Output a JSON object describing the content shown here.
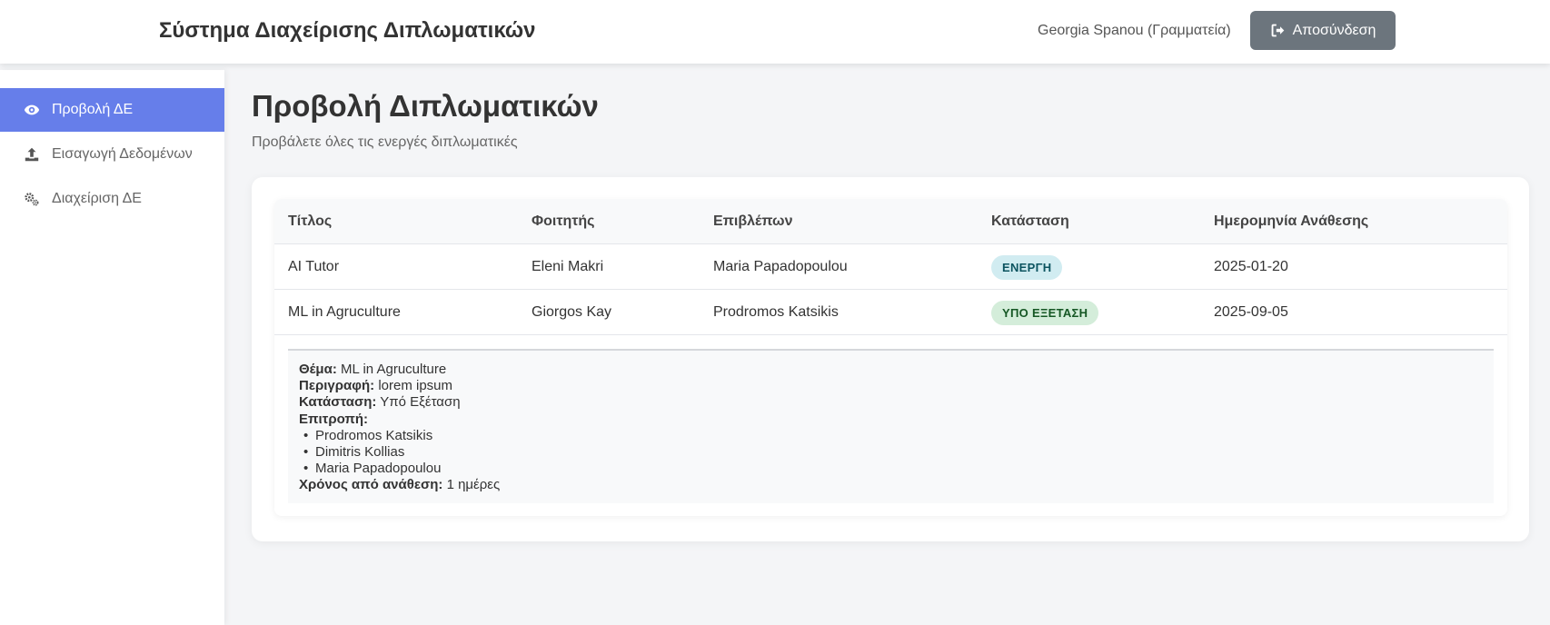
{
  "header": {
    "app_title": "Σύστημα Διαχείρισης Διπλωματικών",
    "user": "Georgia Spanou (Γραμματεία)",
    "logout_label": "Αποσύνδεση",
    "logout_icon": "sign-out-icon"
  },
  "sidebar": {
    "items": [
      {
        "label": "Προβολή ΔΕ",
        "icon": "eye-icon",
        "active": true
      },
      {
        "label": "Εισαγωγή Δεδομένων",
        "icon": "upload-icon",
        "active": false
      },
      {
        "label": "Διαχείριση ΔΕ",
        "icon": "gears-icon",
        "active": false
      }
    ]
  },
  "main": {
    "title": "Προβολή Διπλωματικών",
    "subtitle": "Προβάλετε όλες τις ενεργές διπλωματικές"
  },
  "table": {
    "headers": [
      "Τίτλος",
      "Φοιτητής",
      "Επιβλέπων",
      "Κατάσταση",
      "Ημερομηνία Ανάθεσης"
    ],
    "rows": [
      {
        "title": "AI Tutor",
        "student": "Eleni Makri",
        "supervisor": "Maria Papadopoulou",
        "status": "ΕΝΕΡΓΗ",
        "date": "2025-01-20"
      },
      {
        "title": "ML in Agruculture",
        "student": "Giorgos Kay",
        "supervisor": "Prodromos Katsikis",
        "status": "ΥΠΟ ΕΞΕΤΑΣΗ",
        "date": "2025-09-05"
      }
    ]
  },
  "details": {
    "topic_label": "Θέμα:",
    "topic": "ML in Agruculture",
    "description_label": "Περιγραφή:",
    "description": "lorem ipsum",
    "status_label": "Κατάσταση:",
    "status": "Υπό Εξέταση",
    "committee_label": "Επιτροπή:",
    "committee": [
      "Prodromos Katsikis",
      "Dimitris Kollias",
      "Maria Papadopoulou"
    ],
    "elapsed_label": "Χρόνος από ανάθεση:",
    "elapsed": "1 ημέρες"
  },
  "colors": {
    "accent": "#667eea",
    "logout_button": "#6c757d",
    "badge_active_bg": "#d1ecf1",
    "badge_active_text": "#0c5460",
    "badge_review_bg": "#d4edda",
    "badge_review_text": "#155724"
  }
}
